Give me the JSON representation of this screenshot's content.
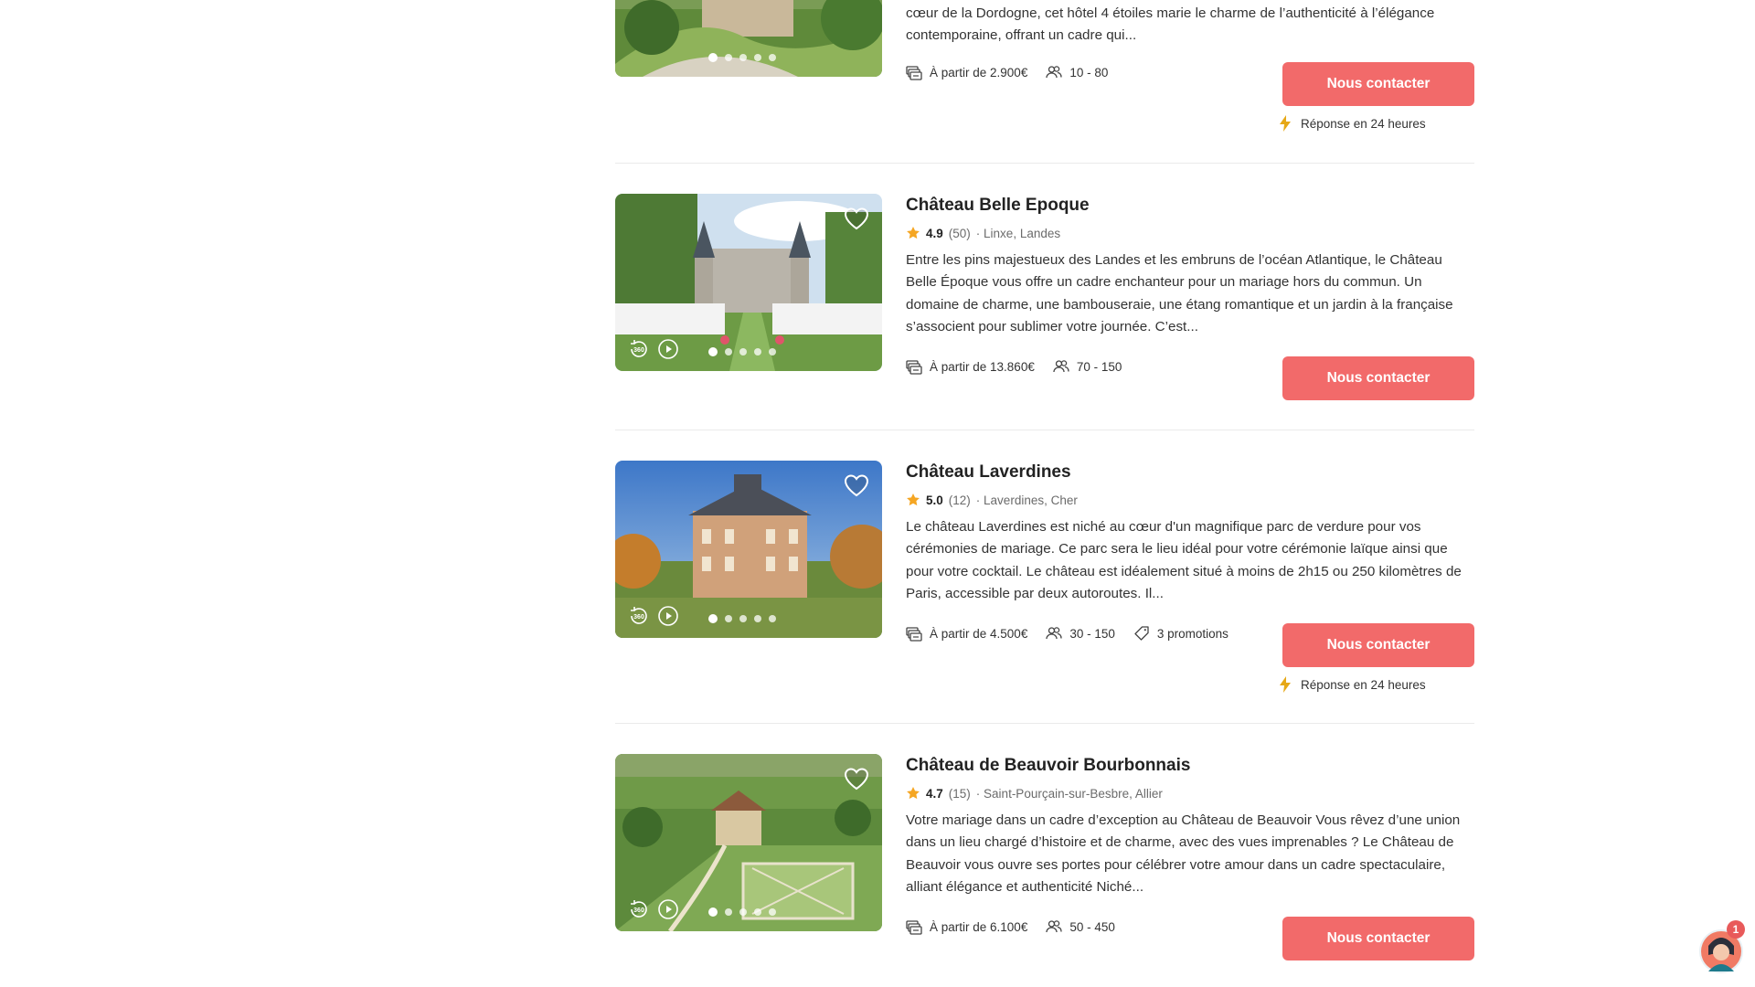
{
  "colors": {
    "accent": "#f26a6a",
    "star": "#f5a623",
    "bolt": "#e6a817",
    "text": "#222222",
    "muted": "#6b6b6b",
    "divider": "#eaeaea"
  },
  "icons": {
    "favorite": "heart-icon",
    "price": "money-icon",
    "guests": "people-icon",
    "promo": "tag-icon",
    "rating": "star-icon",
    "reply": "lightning-icon",
    "tour": "360-icon",
    "video": "play-icon",
    "chat": "chat-avatar-icon"
  },
  "listing0": {
    "desc": "cœur de la Dordogne, cet hôtel 4 étoiles marie le charme de l’authenticité à l’élégance contemporaine, offrant un cadre qui...",
    "price": "À partir de 2.900€",
    "guests": "10 - 80",
    "cta": "Nous contacter",
    "reply": "Réponse en 24 heures"
  },
  "listing1": {
    "title": "Château Belle Epoque",
    "rating": "4.9",
    "reviews": "(50)",
    "location": "· Linxe, Landes",
    "desc": "Entre les pins majestueux des Landes et les embruns de l’océan Atlantique, le Château Belle Époque vous offre un cadre enchanteur pour un mariage hors du commun. Un domaine de charme, une bambouseraie, une étang romantique et un jardin à la française s’associent pour sublimer votre journée. C’est...",
    "price": "À partir de 13.860€",
    "guests": "70 - 150",
    "cta": "Nous contacter"
  },
  "listing2": {
    "title": "Château Laverdines",
    "rating": "5.0",
    "reviews": "(12)",
    "location": "· Laverdines, Cher",
    "desc": "Le château Laverdines est niché au cœur d'un magnifique parc de verdure pour vos cérémonies de mariage. Ce parc sera le lieu idéal pour votre cérémonie laïque ainsi que pour votre cocktail. Le château est idéalement situé à moins de 2h15 ou 250 kilomètres de Paris, accessible par deux autoroutes. Il...",
    "price": "À partir de 4.500€",
    "guests": "30 - 150",
    "promos": "3 promotions",
    "cta": "Nous contacter",
    "reply": "Réponse en 24 heures"
  },
  "listing3": {
    "title": "Château de Beauvoir Bourbonnais",
    "rating": "4.7",
    "reviews": "(15)",
    "location": "· Saint-Pourçain-sur-Besbre, Allier",
    "desc": "Votre mariage dans un cadre d’exception au Château de Beauvoir Vous rêvez d’une union dans un lieu chargé d’histoire et de charme, avec des vues imprenables ? Le Château de Beauvoir vous ouvre ses portes pour célébrer votre amour dans un cadre spectaculaire, alliant élégance et authenticité Niché...",
    "price": "À partir de 6.100€",
    "guests": "50 - 450",
    "cta": "Nous contacter"
  },
  "chat": {
    "badge": "1"
  }
}
